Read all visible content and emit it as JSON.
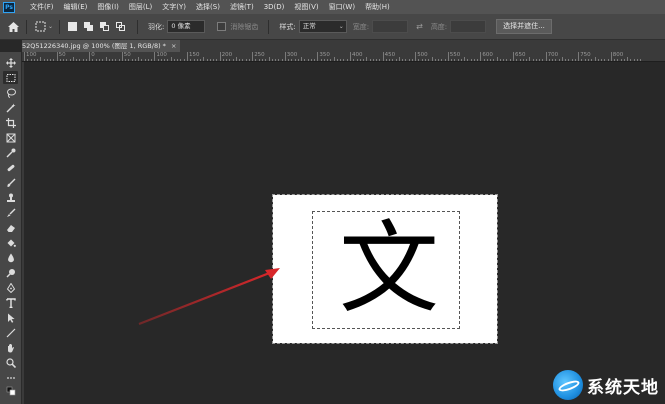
{
  "app": {
    "logo_text": "Ps"
  },
  "menu": {
    "items": [
      {
        "label": "文件(F)"
      },
      {
        "label": "编辑(E)"
      },
      {
        "label": "图像(I)"
      },
      {
        "label": "图层(L)"
      },
      {
        "label": "文字(Y)"
      },
      {
        "label": "选择(S)"
      },
      {
        "label": "滤镜(T)"
      },
      {
        "label": "3D(D)"
      },
      {
        "label": "视图(V)"
      },
      {
        "label": "窗口(W)"
      },
      {
        "label": "帮助(H)"
      }
    ]
  },
  "options": {
    "feather_label": "羽化:",
    "feather_value": "0 像素",
    "antialias_label": "消除锯齿",
    "style_label": "样式:",
    "style_value": "正常",
    "width_label": "宽度:",
    "height_label": "高度:",
    "select_mask_button": "选择并遮住..."
  },
  "document": {
    "tab_title": "52Q51226340.jpg @ 100% (图层 1, RGB/8) *",
    "tab_close": "×",
    "glyph": "文"
  },
  "ruler": {
    "labels": [
      "100",
      "50",
      "0",
      "50",
      "100",
      "150",
      "200",
      "250",
      "300",
      "350",
      "400",
      "450",
      "500",
      "550",
      "600",
      "650",
      "700",
      "750",
      "800"
    ]
  },
  "watermark": {
    "text": "系统天地"
  },
  "colors": {
    "workspace": "#282828",
    "panel": "#474747",
    "menubar": "#535353",
    "arrow": "#d8272a",
    "accent": "#2fa3f5"
  }
}
